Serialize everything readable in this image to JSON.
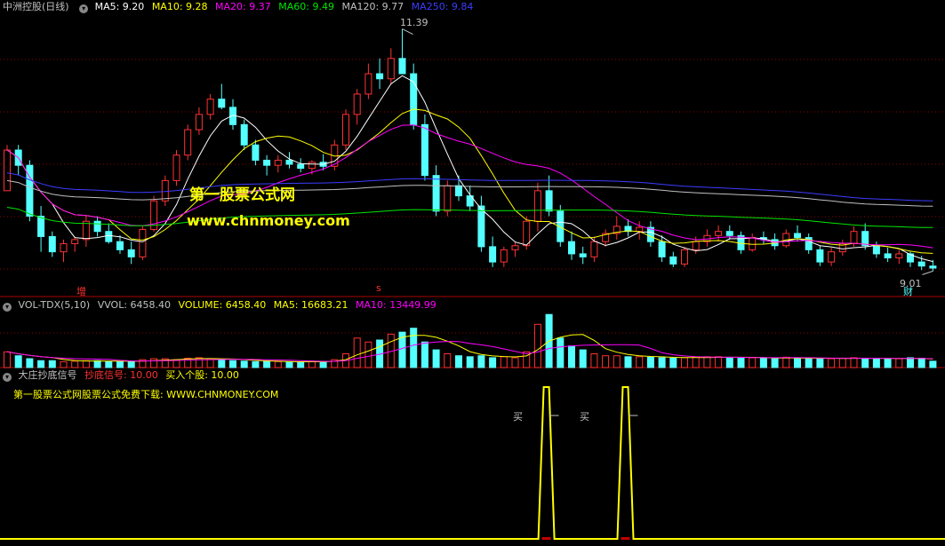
{
  "header": {
    "title": "中洲控股(日线)",
    "ma5": "MA5: 9.20",
    "ma10": "MA10: 9.28",
    "ma20": "MA20: 9.37",
    "ma60": "MA60: 9.49",
    "ma120": "MA120: 9.77",
    "ma250": "MA250: 9.84"
  },
  "price_labels": {
    "high": "11.39",
    "low": "9.01",
    "tag_zeng": "增",
    "tag_s": "s",
    "tag_cai": "财"
  },
  "watermark": {
    "line1": "第一股票公式网",
    "line2": "www.chnmoney.com"
  },
  "vol_header": {
    "name": "VOL-TDX(5,10)",
    "vvol": "VVOL: 6458.40",
    "volume": "VOLUME: 6458.40",
    "ma5": "MA5: 16683.21",
    "ma10": "MA10: 13449.99"
  },
  "sig_header": {
    "name": "大庄抄底信号",
    "signal": "抄底信号: 10.00",
    "buy": "买入个股: 10.00",
    "download": "第一股票公式网股票公式免费下载: WWW.CHNMONEY.COM",
    "buy_mark": "买"
  },
  "colors": {
    "up": "#ff3232",
    "down": "#54ffff",
    "ma5": "#ffffff",
    "ma10": "#ffff00",
    "ma20": "#ff00ff",
    "ma60": "#00e600",
    "ma120": "#c0c0c0",
    "ma250": "#3c3cff",
    "signal": "#ffff00",
    "grid": "#8b0000"
  },
  "chart_data": [
    {
      "type": "candlestick",
      "title": "中洲控股(日线)",
      "price_range": [
        9.01,
        11.39
      ],
      "annotated_high": 11.39,
      "annotated_low": 9.01,
      "candles": [
        [
          9.8,
          10.25,
          9.9,
          10.2
        ],
        [
          10.2,
          10.25,
          9.95,
          10.05
        ],
        [
          10.05,
          10.1,
          9.5,
          9.55
        ],
        [
          9.55,
          9.65,
          9.2,
          9.35
        ],
        [
          9.35,
          9.4,
          9.15,
          9.2
        ],
        [
          9.2,
          9.32,
          9.1,
          9.28
        ],
        [
          9.28,
          9.35,
          9.2,
          9.32
        ],
        [
          9.32,
          9.55,
          9.25,
          9.5
        ],
        [
          9.5,
          9.55,
          9.35,
          9.4
        ],
        [
          9.4,
          9.48,
          9.28,
          9.3
        ],
        [
          9.3,
          9.36,
          9.18,
          9.22
        ],
        [
          9.22,
          9.3,
          9.08,
          9.15
        ],
        [
          9.15,
          9.45,
          9.12,
          9.42
        ],
        [
          9.42,
          9.75,
          9.4,
          9.7
        ],
        [
          9.7,
          9.95,
          9.65,
          9.9
        ],
        [
          9.9,
          10.2,
          9.85,
          10.15
        ],
        [
          10.15,
          10.45,
          10.1,
          10.4
        ],
        [
          10.4,
          10.62,
          10.35,
          10.55
        ],
        [
          10.55,
          10.75,
          10.5,
          10.7
        ],
        [
          10.7,
          10.85,
          10.6,
          10.62
        ],
        [
          10.62,
          10.7,
          10.4,
          10.45
        ],
        [
          10.45,
          10.5,
          10.2,
          10.25
        ],
        [
          10.25,
          10.3,
          10.05,
          10.1
        ],
        [
          10.1,
          10.15,
          9.95,
          10.05
        ],
        [
          10.05,
          10.15,
          9.98,
          10.1
        ],
        [
          10.1,
          10.18,
          10.02,
          10.06
        ],
        [
          10.06,
          10.12,
          9.98,
          10.02
        ],
        [
          10.02,
          10.1,
          9.96,
          10.08
        ],
        [
          10.08,
          10.16,
          10.0,
          10.04
        ],
        [
          10.04,
          10.3,
          10.0,
          10.25
        ],
        [
          10.25,
          10.6,
          10.2,
          10.55
        ],
        [
          10.55,
          10.8,
          10.45,
          10.75
        ],
        [
          10.75,
          11.05,
          10.7,
          10.95
        ],
        [
          10.95,
          11.1,
          10.8,
          10.9
        ],
        [
          10.9,
          11.2,
          10.85,
          11.1
        ],
        [
          11.1,
          11.39,
          11.0,
          10.95
        ],
        [
          10.95,
          11.05,
          10.4,
          10.45
        ],
        [
          10.45,
          10.55,
          9.9,
          9.95
        ],
        [
          9.95,
          10.05,
          9.55,
          9.6
        ],
        [
          9.6,
          9.9,
          9.55,
          9.85
        ],
        [
          9.85,
          9.95,
          9.7,
          9.75
        ],
        [
          9.75,
          9.85,
          9.6,
          9.65
        ],
        [
          9.65,
          9.75,
          9.2,
          9.25
        ],
        [
          9.25,
          9.35,
          9.05,
          9.1
        ],
        [
          9.1,
          9.25,
          9.05,
          9.22
        ],
        [
          9.22,
          9.3,
          9.15,
          9.26
        ],
        [
          9.26,
          9.55,
          9.22,
          9.5
        ],
        [
          9.5,
          9.88,
          9.4,
          9.8
        ],
        [
          9.8,
          9.95,
          9.55,
          9.6
        ],
        [
          9.6,
          9.66,
          9.25,
          9.3
        ],
        [
          9.3,
          9.4,
          9.12,
          9.18
        ],
        [
          9.18,
          9.25,
          9.08,
          9.15
        ],
        [
          9.15,
          9.35,
          9.1,
          9.3
        ],
        [
          9.3,
          9.42,
          9.25,
          9.38
        ],
        [
          9.38,
          9.55,
          9.32,
          9.45
        ],
        [
          9.45,
          9.52,
          9.35,
          9.4
        ],
        [
          9.4,
          9.5,
          9.32,
          9.44
        ],
        [
          9.44,
          9.5,
          9.25,
          9.3
        ],
        [
          9.3,
          9.36,
          9.1,
          9.15
        ],
        [
          9.15,
          9.2,
          9.05,
          9.08
        ],
        [
          9.08,
          9.25,
          9.05,
          9.22
        ],
        [
          9.22,
          9.35,
          9.18,
          9.3
        ],
        [
          9.3,
          9.42,
          9.25,
          9.36
        ],
        [
          9.36,
          9.46,
          9.3,
          9.4
        ],
        [
          9.4,
          9.46,
          9.32,
          9.36
        ],
        [
          9.36,
          9.4,
          9.18,
          9.22
        ],
        [
          9.22,
          9.38,
          9.2,
          9.34
        ],
        [
          9.34,
          9.4,
          9.28,
          9.32
        ],
        [
          9.32,
          9.38,
          9.22,
          9.26
        ],
        [
          9.26,
          9.42,
          9.24,
          9.38
        ],
        [
          9.38,
          9.46,
          9.3,
          9.34
        ],
        [
          9.34,
          9.38,
          9.18,
          9.22
        ],
        [
          9.22,
          9.26,
          9.06,
          9.1
        ],
        [
          9.1,
          9.24,
          9.06,
          9.2
        ],
        [
          9.2,
          9.32,
          9.16,
          9.28
        ],
        [
          9.28,
          9.45,
          9.25,
          9.4
        ],
        [
          9.4,
          9.48,
          9.22,
          9.26
        ],
        [
          9.26,
          9.3,
          9.14,
          9.18
        ],
        [
          9.18,
          9.24,
          9.1,
          9.14
        ],
        [
          9.14,
          9.22,
          9.08,
          9.18
        ],
        [
          9.18,
          9.2,
          9.05,
          9.1
        ],
        [
          9.1,
          9.16,
          9.02,
          9.06
        ],
        [
          9.06,
          9.12,
          9.01,
          9.04
        ]
      ],
      "moving_averages": [
        {
          "name": "MA5",
          "last": 9.2
        },
        {
          "name": "MA10",
          "last": 9.28
        },
        {
          "name": "MA20",
          "last": 9.37
        },
        {
          "name": "MA60",
          "last": 9.49
        },
        {
          "name": "MA120",
          "last": 9.77
        },
        {
          "name": "MA250",
          "last": 9.84
        }
      ]
    },
    {
      "type": "bar",
      "title": "VOL-TDX(5,10)",
      "volume_last": 6458.4,
      "ma5_last": 16683.21,
      "ma10_last": 13449.99,
      "volumes": [
        16000,
        12000,
        9000,
        7000,
        7000,
        6000,
        6500,
        7000,
        7000,
        6000,
        6000,
        6000,
        8000,
        9000,
        9000,
        8000,
        9500,
        10000,
        9000,
        8000,
        7000,
        6500,
        6000,
        6500,
        6000,
        5500,
        5500,
        6500,
        6000,
        8000,
        14000,
        30000,
        26000,
        28000,
        34000,
        36000,
        40000,
        26000,
        18000,
        14000,
        12000,
        11000,
        12000,
        10000,
        11000,
        10000,
        16000,
        44000,
        54000,
        30000,
        22000,
        18000,
        14000,
        12000,
        12000,
        11000,
        11000,
        10500,
        10000,
        9500,
        10000,
        10500,
        11000,
        11000,
        10000,
        10000,
        10000,
        9500,
        9000,
        10500,
        9500,
        9500,
        9000,
        9000,
        9500,
        10000,
        9500,
        9000,
        8500,
        9000,
        10000,
        9500,
        6458
      ]
    },
    {
      "type": "line",
      "title": "大庄抄底信号",
      "signal_value": 10.0,
      "buy_value": 10.0,
      "signal_bar_indices": [
        48,
        55
      ]
    }
  ]
}
